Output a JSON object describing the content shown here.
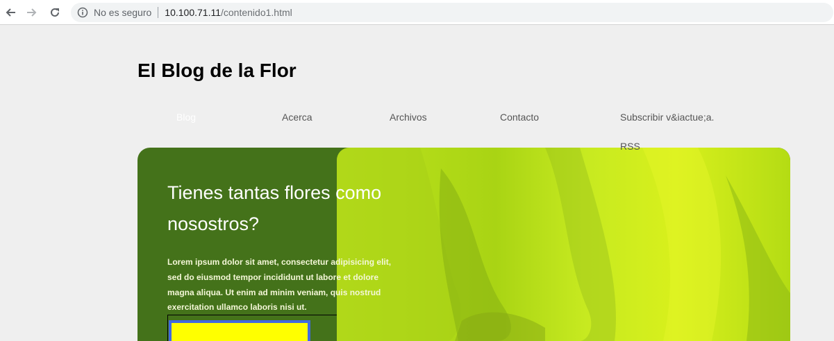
{
  "browser": {
    "security_label": "No es seguro",
    "url_host": "10.100.71.11",
    "url_path": "/contenido1.html"
  },
  "site": {
    "title": "El Blog de la Flor"
  },
  "nav": {
    "items": [
      {
        "label": "Blog",
        "active": true
      },
      {
        "label": "Acerca",
        "active": false
      },
      {
        "label": "Archivos",
        "active": false
      },
      {
        "label": "Contacto",
        "active": false
      },
      {
        "label": "Subscribir v&iactue;a. RSS",
        "active": false
      }
    ]
  },
  "hero": {
    "heading": "Tienes tantas flores como nosostros?",
    "body": "Lorem ipsum dolor sit amet, consectetur adipisicing elit, sed do eiusmod tempor incididunt ut labore et dolore magna aliqua. Ut enim ad minim veniam, quis nostrud exercitation ullamco laboris nisi ut."
  },
  "colors": {
    "hero_green": "#44721a",
    "photo_green": "#bde31c",
    "box_fill": "#ffff00",
    "box_border": "#4169e1"
  }
}
